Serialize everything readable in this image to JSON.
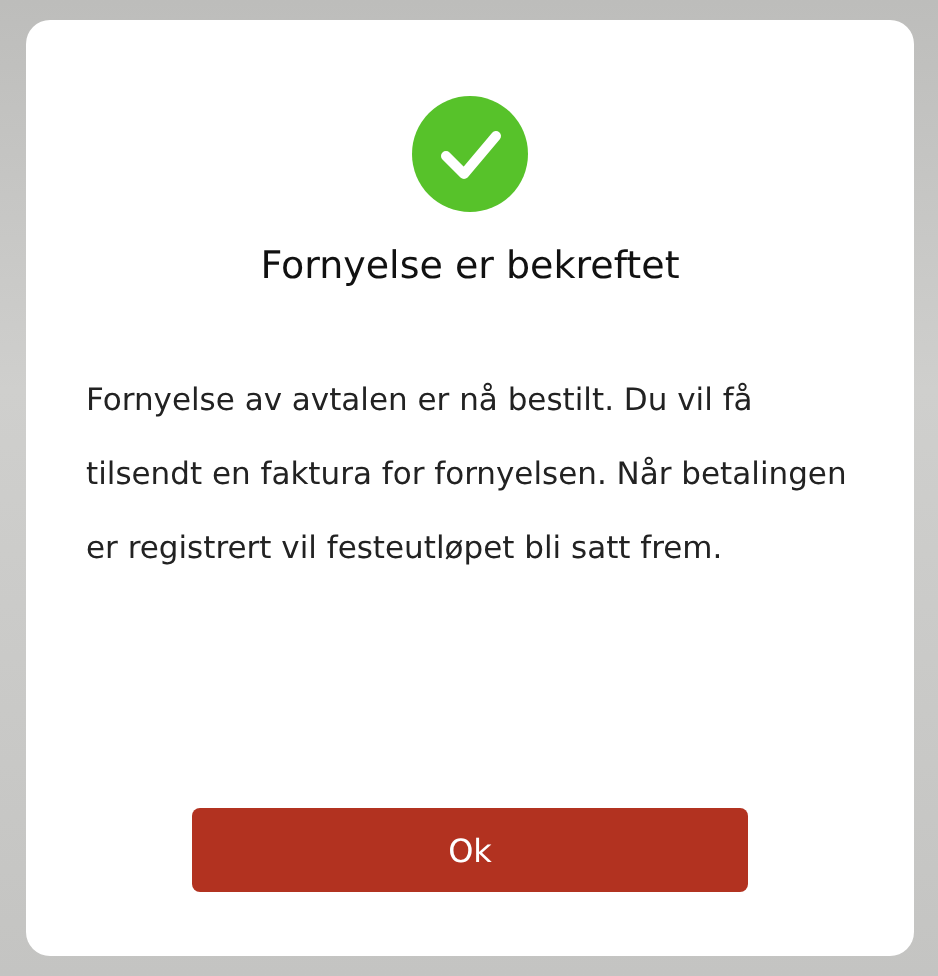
{
  "dialog": {
    "title": "Fornyelse er bekreftet",
    "message": "Fornyelse av avtalen er nå bestilt. Du vil få tilsendt en faktura for fornyelsen. Når betalingen er registrert vil festeutløpet bli satt frem.",
    "button": "Ok"
  }
}
